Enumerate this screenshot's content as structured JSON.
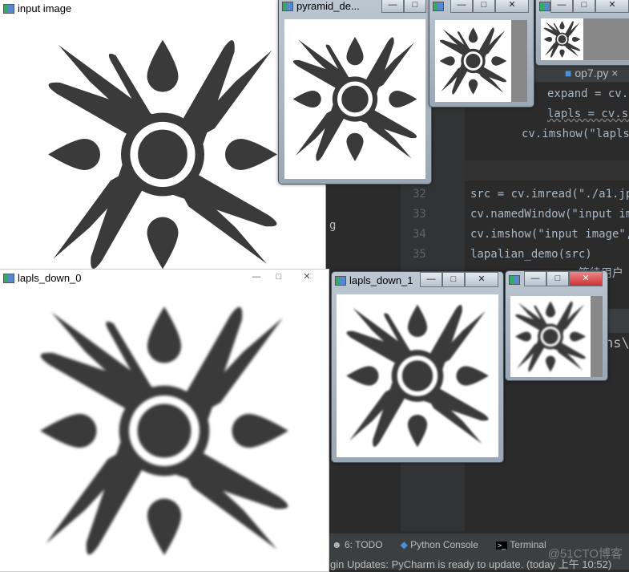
{
  "editor": {
    "tab": "op7.py",
    "lines": [
      {
        "num": "",
        "text": "expand = cv.p"
      },
      {
        "num": "",
        "text": "lapls = cv.su"
      },
      {
        "num": "",
        "text": "cv.imshow(\"lapls_"
      },
      {
        "num": "32",
        "text": "src = cv.imread(\"./a1.jpg"
      },
      {
        "num": "33",
        "text": "cv.namedWindow(\"input ima"
      },
      {
        "num": "34",
        "text": "cv.imshow(\"input image\",s"
      },
      {
        "num": "35",
        "text": "lapalian_demo(src)"
      },
      {
        "num": "",
        "text": "                等待用户"
      }
    ],
    "side_fragment": "g",
    "path_fragment": "ns\\P"
  },
  "windows": [
    {
      "title": "input image"
    },
    {
      "title": "pyramid_de..."
    },
    {
      "title": ""
    },
    {
      "title": ""
    },
    {
      "title": "lapls_down_0"
    },
    {
      "title": "lapls_down_1"
    },
    {
      "title": ""
    }
  ],
  "controls": {
    "minimize": "—",
    "maximize": "□",
    "close": "✕"
  },
  "bottom": {
    "tools": [
      "6: TODO",
      "Python Console",
      "Terminal"
    ],
    "status": "gin Updates: PyCharm is ready to update. (today 上午 10:52)",
    "watermark": "@51CTO博客"
  }
}
